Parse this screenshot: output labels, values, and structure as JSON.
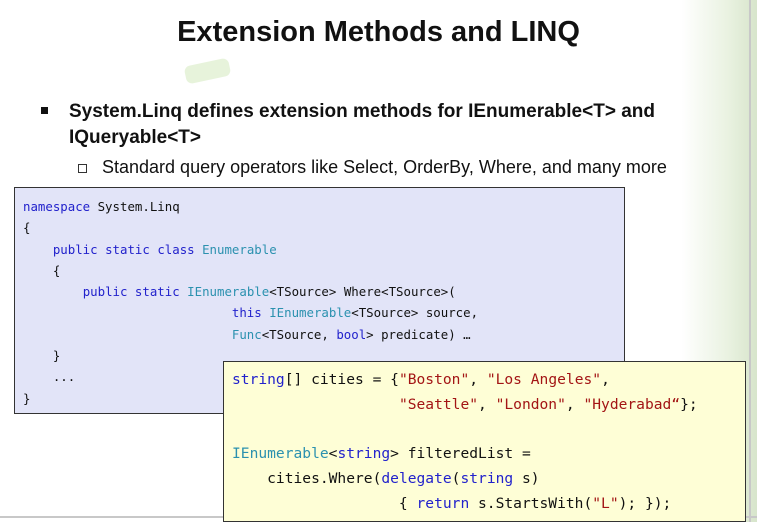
{
  "slide": {
    "title": "Extension Methods and LINQ",
    "bullet": "System.Linq defines extension methods for IEnumerable<T> and IQueryable<T>",
    "sub_bullet": "Standard query operators like Select, OrderBy, Where, and many more"
  },
  "code_box_1": {
    "lines": [
      [
        {
          "t": "namespace",
          "c": "kw"
        },
        {
          "t": " System.Linq",
          "c": ""
        }
      ],
      [
        {
          "t": "{",
          "c": ""
        }
      ],
      [
        {
          "t": "    ",
          "c": ""
        },
        {
          "t": "public",
          "c": "kw"
        },
        {
          "t": " ",
          "c": ""
        },
        {
          "t": "static",
          "c": "kw"
        },
        {
          "t": " ",
          "c": ""
        },
        {
          "t": "class",
          "c": "kw"
        },
        {
          "t": " ",
          "c": ""
        },
        {
          "t": "Enumerable",
          "c": "typ"
        }
      ],
      [
        {
          "t": "    {",
          "c": ""
        }
      ],
      [
        {
          "t": "        ",
          "c": ""
        },
        {
          "t": "public",
          "c": "kw"
        },
        {
          "t": " ",
          "c": ""
        },
        {
          "t": "static",
          "c": "kw"
        },
        {
          "t": " ",
          "c": ""
        },
        {
          "t": "IEnumerable",
          "c": "typ"
        },
        {
          "t": "<TSource> Where<TSource>(",
          "c": ""
        }
      ],
      [
        {
          "t": "                            ",
          "c": ""
        },
        {
          "t": "this",
          "c": "kw"
        },
        {
          "t": " ",
          "c": ""
        },
        {
          "t": "IEnumerable",
          "c": "typ"
        },
        {
          "t": "<TSource> source,",
          "c": ""
        }
      ],
      [
        {
          "t": "                            ",
          "c": ""
        },
        {
          "t": "Func",
          "c": "typ"
        },
        {
          "t": "<TSource, ",
          "c": ""
        },
        {
          "t": "bool",
          "c": "kw"
        },
        {
          "t": "> predicate) …",
          "c": ""
        }
      ],
      [
        {
          "t": "    }",
          "c": ""
        }
      ],
      [
        {
          "t": "    ...",
          "c": ""
        }
      ],
      [
        {
          "t": "}",
          "c": ""
        }
      ]
    ]
  },
  "code_box_2": {
    "lines": [
      [
        {
          "t": "string",
          "c": "kw"
        },
        {
          "t": "[] cities = {",
          "c": ""
        },
        {
          "t": "\"Boston\"",
          "c": "str"
        },
        {
          "t": ", ",
          "c": ""
        },
        {
          "t": "\"Los Angeles\"",
          "c": "str"
        },
        {
          "t": ",",
          "c": ""
        }
      ],
      [
        {
          "t": "                   ",
          "c": ""
        },
        {
          "t": "\"Seattle\"",
          "c": "str"
        },
        {
          "t": ", ",
          "c": ""
        },
        {
          "t": "\"London\"",
          "c": "str"
        },
        {
          "t": ", ",
          "c": ""
        },
        {
          "t": "\"Hyderabad“",
          "c": "str"
        },
        {
          "t": "};",
          "c": ""
        }
      ],
      [
        {
          "t": "",
          "c": ""
        }
      ],
      [
        {
          "t": "IEnumerable",
          "c": "typ"
        },
        {
          "t": "<",
          "c": ""
        },
        {
          "t": "string",
          "c": "kw"
        },
        {
          "t": "> filteredList =",
          "c": ""
        }
      ],
      [
        {
          "t": "    cities.Where(",
          "c": ""
        },
        {
          "t": "delegate",
          "c": "kw"
        },
        {
          "t": "(",
          "c": ""
        },
        {
          "t": "string",
          "c": "kw"
        },
        {
          "t": " s)",
          "c": ""
        }
      ],
      [
        {
          "t": "                   { ",
          "c": ""
        },
        {
          "t": "return",
          "c": "kw"
        },
        {
          "t": " s.StartsWith(",
          "c": ""
        },
        {
          "t": "\"L\"",
          "c": "str"
        },
        {
          "t": "); });",
          "c": ""
        }
      ]
    ]
  }
}
